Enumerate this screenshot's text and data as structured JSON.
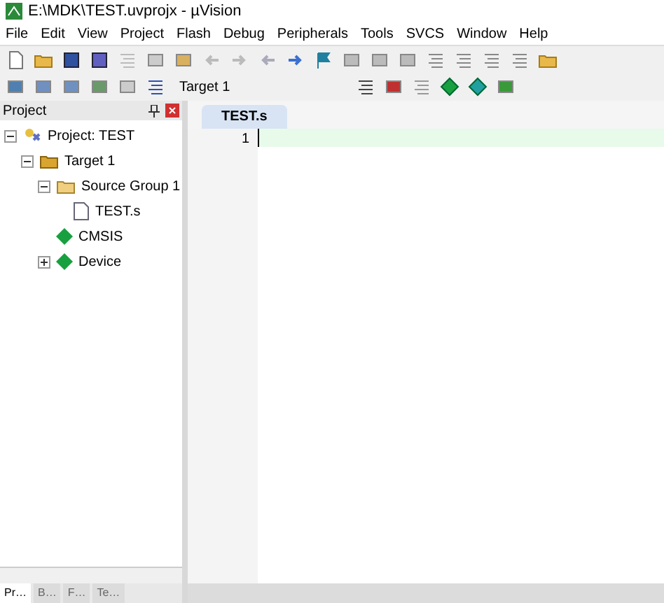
{
  "window": {
    "title": "E:\\MDK\\TEST.uvprojx - µVision"
  },
  "menu": [
    "File",
    "Edit",
    "View",
    "Project",
    "Flash",
    "Debug",
    "Peripherals",
    "Tools",
    "SVCS",
    "Window",
    "Help"
  ],
  "toolbar2": {
    "target": "Target 1"
  },
  "project_panel": {
    "title": "Project",
    "tree": [
      {
        "label": "Project: TEST",
        "kind": "project",
        "expanded": true,
        "children": [
          {
            "label": "Target 1",
            "kind": "target",
            "expanded": true,
            "children": [
              {
                "label": "Source Group 1",
                "kind": "group",
                "expanded": true,
                "children": [
                  {
                    "label": "TEST.s",
                    "kind": "file"
                  }
                ]
              },
              {
                "label": "CMSIS",
                "kind": "component"
              },
              {
                "label": "Device",
                "kind": "component",
                "expanded": false
              }
            ]
          }
        ]
      }
    ],
    "bottom_tabs": [
      {
        "label": "Pr…",
        "selected": true
      },
      {
        "label": "B…",
        "selected": false
      },
      {
        "label": "F…",
        "selected": false
      },
      {
        "label": "Te…",
        "selected": false
      }
    ]
  },
  "editor": {
    "tabs": [
      {
        "label": "TEST.s",
        "selected": true
      }
    ],
    "lines": [
      {
        "number": "1"
      }
    ]
  }
}
